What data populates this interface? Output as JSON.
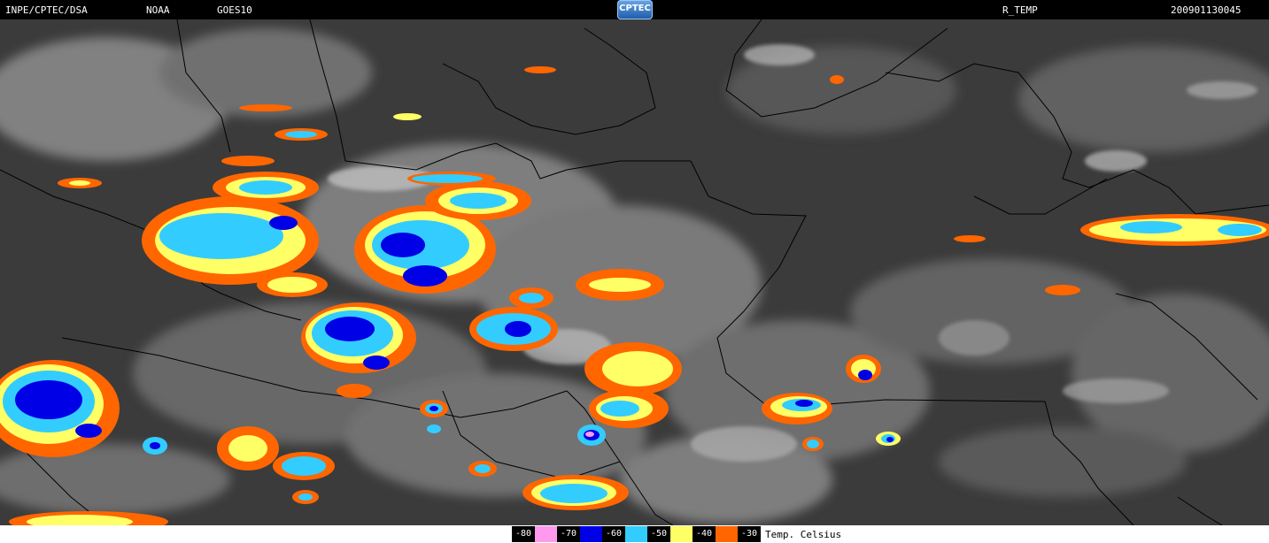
{
  "header": {
    "source": "INPE/CPTEC/DSA",
    "agency": "NOAA",
    "satellite": "GOES10",
    "logo_text": "CPTEC",
    "product": "R_TEMP",
    "timestamp": "200901130045"
  },
  "legend": {
    "title": "Temp. Celsius",
    "entries": [
      {
        "label": "-80",
        "color": "#ff99ee"
      },
      {
        "label": "-70",
        "color": "#0000e6"
      },
      {
        "label": "-60",
        "color": "#33ccff"
      },
      {
        "label": "-50",
        "color": "#ffff66"
      },
      {
        "label": "-40",
        "color": "#ff6600"
      },
      {
        "label": "-30",
        "color": "#ffffff"
      }
    ]
  },
  "colors": {
    "background_ir": "#3c3c3c",
    "cloud_gray": "#9a9a9a",
    "cloud_light": "#c8c8c8",
    "borders": "#000000"
  }
}
